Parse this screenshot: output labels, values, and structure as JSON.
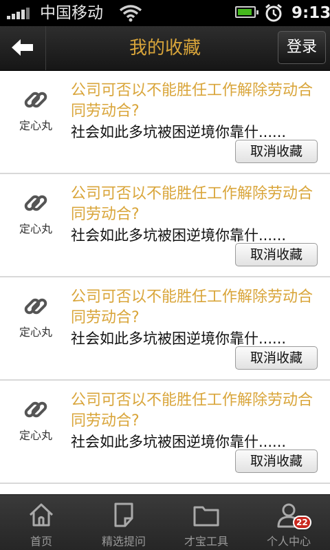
{
  "status_bar": {
    "carrier": "中国移动",
    "time": "9:13",
    "battery_color": "#46b81e"
  },
  "header": {
    "title": "我的收藏",
    "login_label": "登录",
    "back_icon": "back-arrow-icon"
  },
  "favorites": [
    {
      "source": "定心丸",
      "title": "公司可否以不能胜任工作解除劳动合同劳动合?",
      "summary": "社会如此多坑被困逆境你靠什......",
      "cancel_label": "取消收藏",
      "icon": "link-icon"
    },
    {
      "source": "定心丸",
      "title": "公司可否以不能胜任工作解除劳动合同劳动合?",
      "summary": "社会如此多坑被困逆境你靠什......",
      "cancel_label": "取消收藏",
      "icon": "link-icon"
    },
    {
      "source": "定心丸",
      "title": "公司可否以不能胜任工作解除劳动合同劳动合?",
      "summary": "社会如此多坑被困逆境你靠什......",
      "cancel_label": "取消收藏",
      "icon": "link-icon"
    },
    {
      "source": "定心丸",
      "title": "公司可否以不能胜任工作解除劳动合同劳动合?",
      "summary": "社会如此多坑被困逆境你靠什......",
      "cancel_label": "取消收藏",
      "icon": "link-icon"
    }
  ],
  "tabs": [
    {
      "label": "首页",
      "icon": "home-icon"
    },
    {
      "label": "精选提问",
      "icon": "note-icon"
    },
    {
      "label": "才宝工具",
      "icon": "folder-icon"
    },
    {
      "label": "个人中心",
      "icon": "person-icon",
      "badge": "22"
    }
  ],
  "colors": {
    "accent": "#d9a53a",
    "badge": "#c8281f",
    "header_bg": "#1e1e1e"
  }
}
